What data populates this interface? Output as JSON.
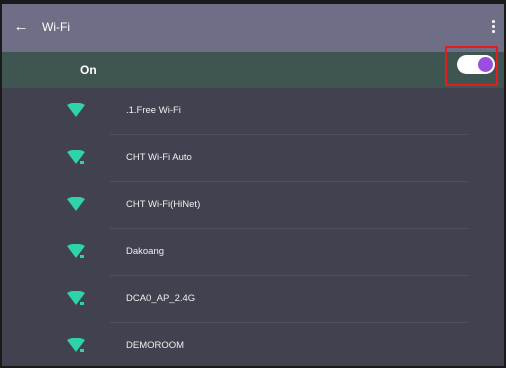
{
  "header": {
    "title": "Wi-Fi",
    "back_icon": "arrow-back-icon",
    "menu_icon": "more-vert-icon"
  },
  "wifi_toggle": {
    "label": "On",
    "state": "on",
    "accent_color": "#9b4de0",
    "highlight_color": "#e21d1d"
  },
  "networks": [
    {
      "ssid": ".1.Free Wi-Fi",
      "secured": false
    },
    {
      "ssid": "CHT Wi-Fi Auto",
      "secured": true
    },
    {
      "ssid": "CHT Wi-Fi(HiNet)",
      "secured": false
    },
    {
      "ssid": "Dakoang",
      "secured": true
    },
    {
      "ssid": "DCA0_AP_2.4G",
      "secured": true
    },
    {
      "ssid": "DEMOROOM",
      "secured": true
    }
  ],
  "colors": {
    "topbar": "#6e6e86",
    "on_bar": "#3f5551",
    "background": "#41414f",
    "wifi_icon": "#2fd3a8"
  }
}
